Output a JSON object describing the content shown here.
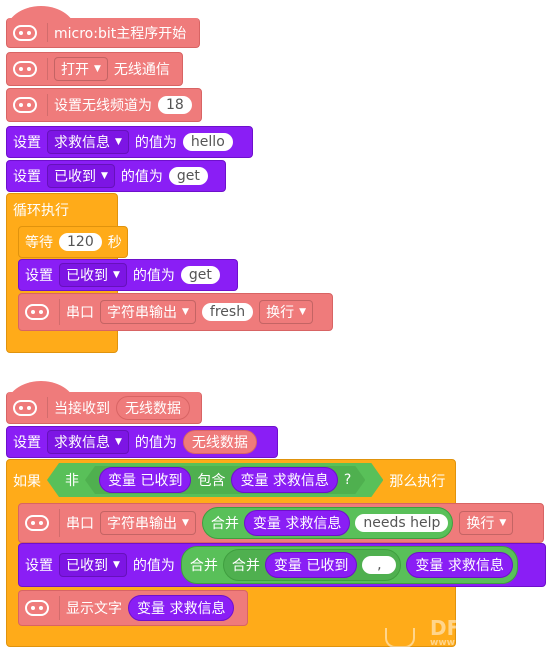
{
  "colors": {
    "microbit": "#ef7b7b",
    "variable": "#8a1ef5",
    "control": "#ffab19",
    "operator": "#59c059"
  },
  "script1": {
    "hat_label": "micro:bit主程序开始",
    "radio_toggle": {
      "option": "打开",
      "label": "无线通信"
    },
    "set_channel": {
      "label": "设置无线频道为",
      "value": "18"
    },
    "set_var1": {
      "set": "设置",
      "var": "求救信息",
      "to": "的值为",
      "value": "hello"
    },
    "set_var2": {
      "set": "设置",
      "var": "已收到",
      "to": "的值为",
      "value": "get"
    },
    "forever": {
      "label": "循环执行"
    },
    "wait": {
      "label": "等待",
      "value": "120",
      "unit": "秒"
    },
    "set_var3": {
      "set": "设置",
      "var": "已收到",
      "to": "的值为",
      "value": "get"
    },
    "serial": {
      "label": "串口",
      "mode": "字符串输出",
      "value": "fresh",
      "newline": "换行"
    }
  },
  "script2": {
    "hat": {
      "label": "当接收到",
      "param": "无线数据"
    },
    "set_var": {
      "set": "设置",
      "var": "求救信息",
      "to": "的值为",
      "value": "无线数据"
    },
    "if": {
      "if": "如果",
      "not": "非",
      "var_a": "变量 已收到",
      "contains": "包含",
      "var_b": "变量 求救信息",
      "q": "?",
      "then": "那么执行"
    },
    "serial": {
      "label": "串口",
      "mode": "字符串输出",
      "join": "合并",
      "var": "变量 求救信息",
      "text": "needs help",
      "newline": "换行"
    },
    "set_join": {
      "set": "设置",
      "var": "已收到",
      "to": "的值为",
      "join1": "合并",
      "join2": "合并",
      "var_a": "变量 已收到",
      "sep": ",",
      "var_b": "变量 求救信息"
    },
    "show": {
      "label": "显示文字",
      "var": "变量 求救信息"
    }
  },
  "watermark": {
    "text": "DF",
    "sub": "www"
  }
}
